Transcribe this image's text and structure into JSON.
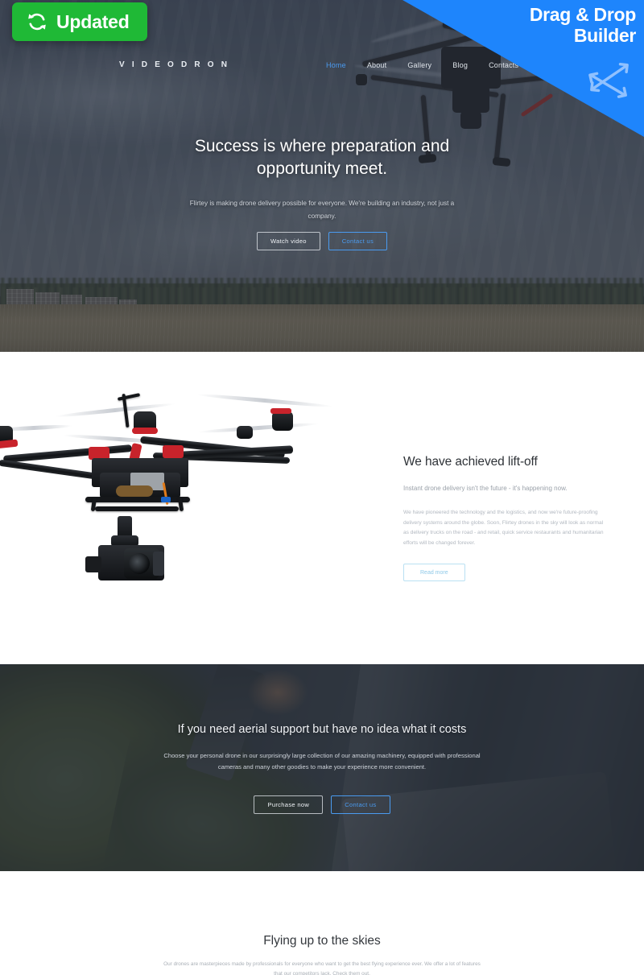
{
  "badge": {
    "label": "Updated",
    "icon": "refresh-sync-icon",
    "color": "#1fb936"
  },
  "ribbon": {
    "line1": "Drag & Drop",
    "line2": "Builder",
    "icon": "move-four-arrows-icon",
    "color": "#1e85fc"
  },
  "header": {
    "logo": "V I D E O D R O N",
    "nav": [
      {
        "label": "Home",
        "active": true
      },
      {
        "label": "About",
        "active": false
      },
      {
        "label": "Gallery",
        "active": false
      },
      {
        "label": "Blog",
        "active": false
      },
      {
        "label": "Contacts",
        "active": false
      }
    ],
    "accent": "#4a9bf0"
  },
  "hero": {
    "title": "Success is where preparation and opportunity meet.",
    "subtitle": "Flirtey is making drone delivery possible for everyone. We're building an industry, not just a company.",
    "buttons": [
      {
        "label": "Watch video",
        "style": "ghost"
      },
      {
        "label": "Contact us",
        "style": "blue"
      }
    ]
  },
  "liftoff": {
    "image_alt": "hexacopter-drone-with-camera-gimbal",
    "title": "We have achieved lift-off",
    "lead": "Instant drone delivery isn't the future - it's happening now.",
    "body": "We have pioneered the technology and the logistics, and now we're future-proofing delivery systems around the globe. Soon, Flirtey drones in the sky will look as normal as delivery trucks on the road - and retail, quick service restaurants and humanitarian efforts will be changed forever.",
    "button": "Read more"
  },
  "aerial": {
    "title": "If you need aerial support but have no idea what it costs",
    "subtitle": "Choose your personal drone in our surprisingly large collection of our amazing machinery, equipped with professional cameras and many other goodies to make your experience more convenient.",
    "buttons": [
      {
        "label": "Purchase now",
        "style": "ghost"
      },
      {
        "label": "Contact us",
        "style": "blue"
      }
    ]
  },
  "flying": {
    "title": "Flying up to the skies",
    "subtitle": "Our drones are masterpieces made by professionals for everyone who want to get the best flying experience ever. We offer a lot of features that our competitors lack. Check them out."
  }
}
